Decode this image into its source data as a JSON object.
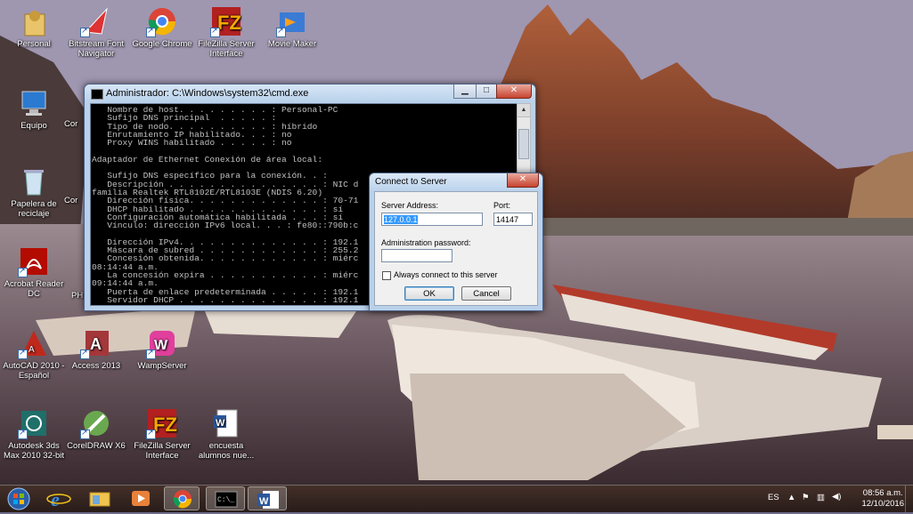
{
  "desktop": {
    "icons": [
      {
        "label": "Personal",
        "icon": "user-folder-icon"
      },
      {
        "label": "Bitstream Font Navigator",
        "icon": "font-navigator-icon"
      },
      {
        "label": "Google Chrome",
        "icon": "chrome-icon"
      },
      {
        "label": "FileZilla Server Interface",
        "icon": "filezilla-icon"
      },
      {
        "label": "Movie Maker",
        "icon": "movie-maker-icon"
      },
      {
        "label": "Equipo",
        "icon": "computer-icon"
      },
      {
        "label": "Papelera de reciclaje",
        "icon": "recycle-bin-icon"
      },
      {
        "label": "Acrobat Reader DC",
        "icon": "acrobat-icon"
      },
      {
        "label": "AutoCAD 2010 - Español",
        "icon": "autocad-icon"
      },
      {
        "label": "Access 2013",
        "icon": "access-icon"
      },
      {
        "label": "WampServer",
        "icon": "wampserver-icon"
      },
      {
        "label": "Autodesk 3ds Max 2010 32-bit",
        "icon": "3dsmax-icon"
      },
      {
        "label": "CorelDRAW X6",
        "icon": "coreldraw-icon"
      },
      {
        "label": "FileZilla Server Interface",
        "icon": "filezilla-icon"
      },
      {
        "label": "encuesta alumnos nue...",
        "icon": "word-doc-icon"
      }
    ],
    "partial_labels": {
      "cor1": "Cor",
      "cor2": "Cor",
      "ph": "PH"
    }
  },
  "cmd_window": {
    "title": "Administrador: C:\\Windows\\system32\\cmd.exe",
    "buttons": {
      "minimize": "▁",
      "maximize": "□",
      "close": "✕"
    },
    "lines": [
      "   Nombre de host. . . . . . . . . : Personal-PC",
      "   Sufijo DNS principal  . . . . . :",
      "   Tipo de nodo. . . . . . . . . . : híbrido",
      "   Enrutamiento IP habilitado. . . : no",
      "   Proxy WINS habilitado . . . . . : no",
      "",
      "Adaptador de Ethernet Conexión de área local:",
      "",
      "   Sufijo DNS específico para la conexión. . :",
      "   Descripción . . . . . . . . . . . . . . . : NIC d",
      "familia Realtek RTL8102E/RTL8103E (NDIS 6.20)",
      "   Dirección física. . . . . . . . . . . . . : 70-71",
      "   DHCP habilitado . . . . . . . . . . . . . : sí",
      "   Configuración automática habilitada . . . : sí",
      "   Vínculo: dirección IPv6 local. . . : fe80::790b:c",
      "",
      "   Dirección IPv4. . . . . . . . . . . . . . : 192.1",
      "   Máscara de subred . . . . . . . . . . . . : 255.2",
      "   Concesión obtenida. . . . . . . . . . . . : miérc",
      "08:14:44 a.m.",
      "   La concesión expira . . . . . . . . . . . : miérc",
      "09:14:44 a.m.",
      "   Puerta de enlace predeterminada . . . . . : 192.1",
      "   Servidor DHCP . . . . . . . . . . . . . . : 192.1"
    ]
  },
  "connect_dialog": {
    "title": "Connect to Server",
    "close": "✕",
    "server_address_label": "Server Address:",
    "server_address_value": "127.0.0.1",
    "port_label": "Port:",
    "port_value": "14147",
    "password_label": "Administration password:",
    "password_value": "",
    "always_connect_label": "Always connect to this server",
    "always_connect_checked": false,
    "ok_label": "OK",
    "cancel_label": "Cancel"
  },
  "taskbar": {
    "start": "start-orb-icon",
    "pinned": [
      "internet-explorer-icon",
      "explorer-folder-icon",
      "media-player-icon",
      "chrome-icon",
      "cmd-icon",
      "word-icon"
    ],
    "language": "ES",
    "time": "08:56 a.m.",
    "date": "12/10/2016"
  }
}
